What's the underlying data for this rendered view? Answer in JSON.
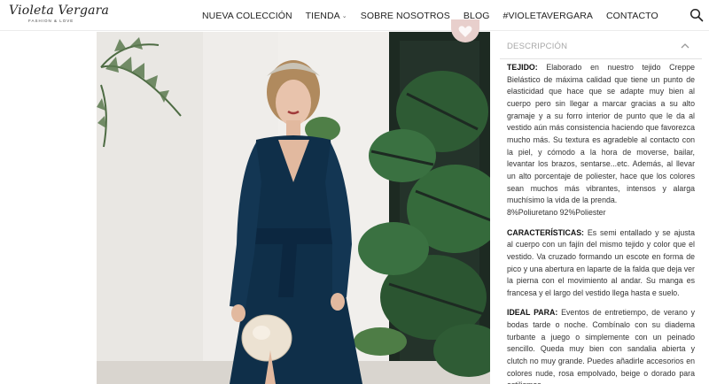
{
  "brand": {
    "logo_text": "Violeta Vergara",
    "tagline": "FASHION & LOVE"
  },
  "nav": {
    "items": [
      {
        "label": "NUEVA COLECCIÓN"
      },
      {
        "label": "TIENDA"
      },
      {
        "label": "SOBRE NOSOTROS"
      },
      {
        "label": "BLOG"
      },
      {
        "label": "#VIOLETAVERGARA"
      },
      {
        "label": "CONTACTO"
      }
    ]
  },
  "icons": {
    "search": "search-icon",
    "dropdown": "chevron-down-icon",
    "collapse": "chevron-up-icon",
    "favorite": "heart-icon"
  },
  "colors": {
    "accent_pink": "#e8cfcc",
    "dress_navy": "#0f2f49",
    "leaf_green": "#2f5a34"
  },
  "description": {
    "title": "DESCRIPCIÓN",
    "tejido_label": "TEJIDO:",
    "tejido_text": "Elaborado en nuestro tejido Creppe Bielástico de máxima calidad que tiene un punto de elasticidad que hace que se adapte muy bien al cuerpo pero sin llegar a marcar gracias a su alto gramaje y a su forro interior de punto que le da al vestido aún más consistencia haciendo que favorezca mucho más. Su textura es agradeble al contacto con la piel, y cómodo a la hora de moverse, bailar, levantar los brazos, sentarse...etc. Además, al llevar un alto porcentaje de poliester, hace que los colores sean muchos más vibrantes, intensos y alarga muchísimo la vida de la prenda.",
    "composition": "8%Poliuretano 92%Poliester",
    "caracteristicas_label": "CARACTERÍSTICAS:",
    "caracteristicas_text": "Es semi entallado y se ajusta al cuerpo con un fajín del mismo tejido y color que el vestido. Va cruzado formando un escote en forma de pico y una abertura en laparte de la falda que deja ver la pierna con el movimiento al andar. Su manga es francesa y el largo del vestido llega hasta e suelo.",
    "ideal_label": "IDEAL PARA:",
    "ideal_text": "Eventos de entretiempo, de verano y bodas tarde o noche. Combínalo con su diadema turbante a juego o simplemente con un peinado sencillo. Queda muy bien con sandalia abierta y clutch no muy grande. Puedes añadirle accesorios en colores nude, rosa empolvado, beige o dorado para estilismos"
  }
}
